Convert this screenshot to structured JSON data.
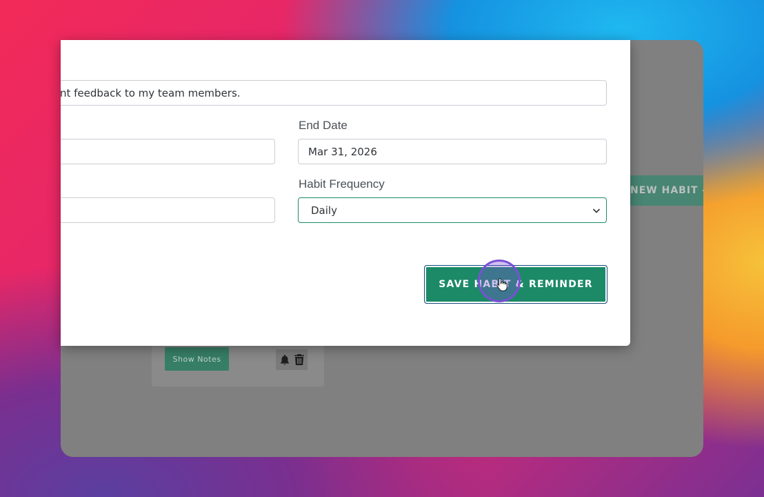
{
  "background_page": {
    "new_habit_button": {
      "label": "NEW HABIT",
      "icon": "plus-icon"
    },
    "habit_card": {
      "show_notes_label": "Show Notes",
      "icons": [
        "bell-icon",
        "trash-icon"
      ]
    }
  },
  "modal": {
    "description": {
      "value": "nt feedback to my team members."
    },
    "start_date": {
      "value": ""
    },
    "end_date": {
      "label": "End Date",
      "value": "Mar 31, 2026"
    },
    "reminder": {
      "value": ""
    },
    "frequency": {
      "label": "Habit Frequency",
      "selected": "Daily",
      "icon": "chevron-down-icon"
    },
    "save_button": {
      "label": "SAVE HABIT & REMINDER"
    }
  },
  "colors": {
    "accent_green": "#1c8a67",
    "overlay_gray": "#808080",
    "click_highlight": "#7b4fd6"
  }
}
